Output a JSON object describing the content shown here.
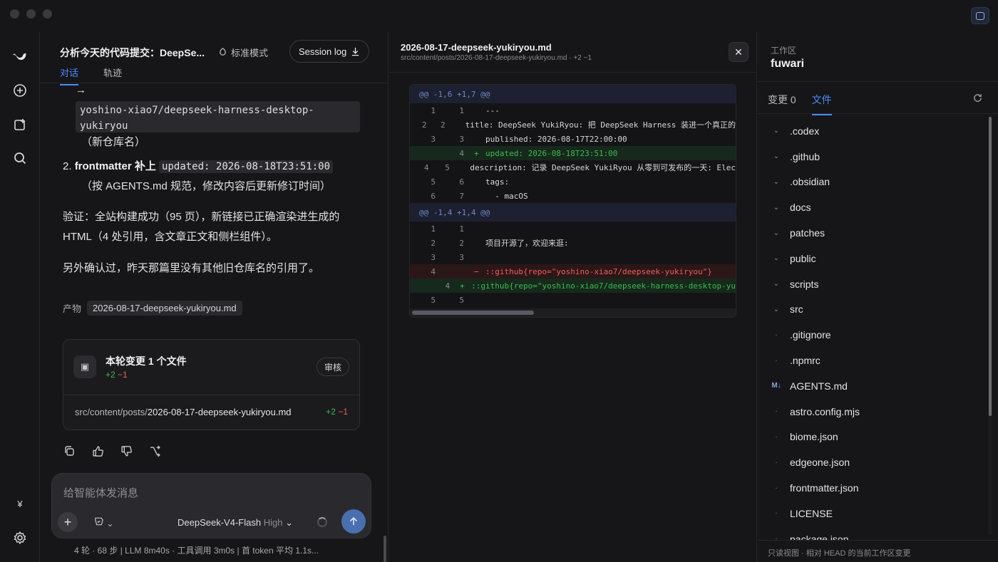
{
  "chat": {
    "title": "分析今天的代码提交：DeepSe...",
    "mode": "标准模式",
    "session_log": "Session log",
    "tabs": [
      "对话",
      "轨迹"
    ],
    "arrow_line": "→",
    "repo_code": "yoshino-xiao7/deepseek-harness-desktop-yukiryou",
    "repo_note": "（新仓库名）",
    "item2_num": "2.",
    "item2_text": "frontmatter 补上",
    "item2_code": "updated: 2026-08-18T23:51:00",
    "item2_note": "（按 AGENTS.md 规范，修改内容后更新修订时间）",
    "verify_line1": "验证：全站构建成功（95 页），新链接已正确渲染进生成的",
    "verify_line2": "HTML（4 处引用，含文章正文和侧栏组件）。",
    "confirm_line": "另外确认过，昨天那篇里没有其他旧仓库名的引用了。",
    "artifact_label": "产物",
    "artifact_file": "2026-08-17-deepseek-yukiryou.md",
    "change_card": {
      "title": "本轮变更 1 个文件",
      "added": "+2",
      "removed": "−1",
      "review": "审核",
      "file_dir": "src/content/posts/",
      "file_name": "2026-08-17-deepseek-yukiryou.md",
      "file_added": "+2",
      "file_removed": "−1"
    },
    "composer_placeholder": "给智能体发消息",
    "model_name": "DeepSeek-V4-Flash",
    "model_effort": "High",
    "footer_stats": "4 轮 · 68 步  |  LLM 8m40s · 工具调用 3m0s  |  首 token 平均 1.1s..."
  },
  "diff": {
    "title": "2026-08-17-deepseek-yukiryou.md",
    "subtitle": "src/content/posts/2026-08-17-deepseek-yukiryou.md · +2 −1",
    "hunks": [
      {
        "header": "@@ -1,6 +1,7 @@",
        "lines": [
          {
            "old": "1",
            "new": "1",
            "type": "ctx",
            "text": "---"
          },
          {
            "old": "2",
            "new": "2",
            "type": "ctx",
            "text": "title: DeepSeek YukiRyou: 把 DeepSeek Harness 装进一个真正的"
          },
          {
            "old": "3",
            "new": "3",
            "type": "ctx",
            "text": "published: 2026-08-17T22:00:00"
          },
          {
            "old": "",
            "new": "4",
            "type": "add",
            "text": "updated: 2026-08-18T23:51:00"
          },
          {
            "old": "4",
            "new": "5",
            "type": "ctx",
            "text": "description: 记录 DeepSeek YukiRyou 从零到可发布的一天: Elec"
          },
          {
            "old": "5",
            "new": "6",
            "type": "ctx",
            "text": "tags:"
          },
          {
            "old": "6",
            "new": "7",
            "type": "ctx",
            "text": "  - macOS"
          }
        ]
      },
      {
        "header": "@@ -1,4 +1,4 @@",
        "lines": [
          {
            "old": "1",
            "new": "1",
            "type": "ctx",
            "text": ""
          },
          {
            "old": "2",
            "new": "2",
            "type": "ctx",
            "text": "项目开源了，欢迎来逛:"
          },
          {
            "old": "3",
            "new": "3",
            "type": "ctx",
            "text": ""
          },
          {
            "old": "4",
            "new": "",
            "type": "del",
            "text": "::github{repo=\"yoshino-xiao7/deepseek-yukiryou\"}"
          },
          {
            "old": "",
            "new": "4",
            "type": "add",
            "text": "::github{repo=\"yoshino-xiao7/deepseek-harness-desktop-yu"
          },
          {
            "old": "5",
            "new": "5",
            "type": "ctx",
            "text": ""
          }
        ]
      }
    ]
  },
  "workspace": {
    "label": "工作区",
    "name": "fuwari",
    "tab_changes": "变更 0",
    "tab_files": "文件",
    "files": [
      {
        "name": ".codex",
        "marker": "⌄"
      },
      {
        "name": ".github",
        "marker": "⌄"
      },
      {
        "name": ".obsidian",
        "marker": "⌄"
      },
      {
        "name": "docs",
        "marker": "⌄"
      },
      {
        "name": "patches",
        "marker": "⌄"
      },
      {
        "name": "public",
        "marker": "⌄"
      },
      {
        "name": "scripts",
        "marker": "⌄"
      },
      {
        "name": "src",
        "marker": "⌄"
      },
      {
        "name": ".gitignore",
        "marker": "·"
      },
      {
        "name": ".npmrc",
        "marker": "·"
      },
      {
        "name": "AGENTS.md",
        "marker": "M↓"
      },
      {
        "name": "astro.config.mjs",
        "marker": "·"
      },
      {
        "name": "biome.json",
        "marker": "·"
      },
      {
        "name": "edgeone.json",
        "marker": "·"
      },
      {
        "name": "frontmatter.json",
        "marker": "·"
      },
      {
        "name": "LICENSE",
        "marker": "·"
      },
      {
        "name": "package.json",
        "marker": "·"
      }
    ],
    "footer": "只读视图 · 相对 HEAD 的当前工作区变更"
  },
  "rail": {
    "currency": "¥"
  }
}
